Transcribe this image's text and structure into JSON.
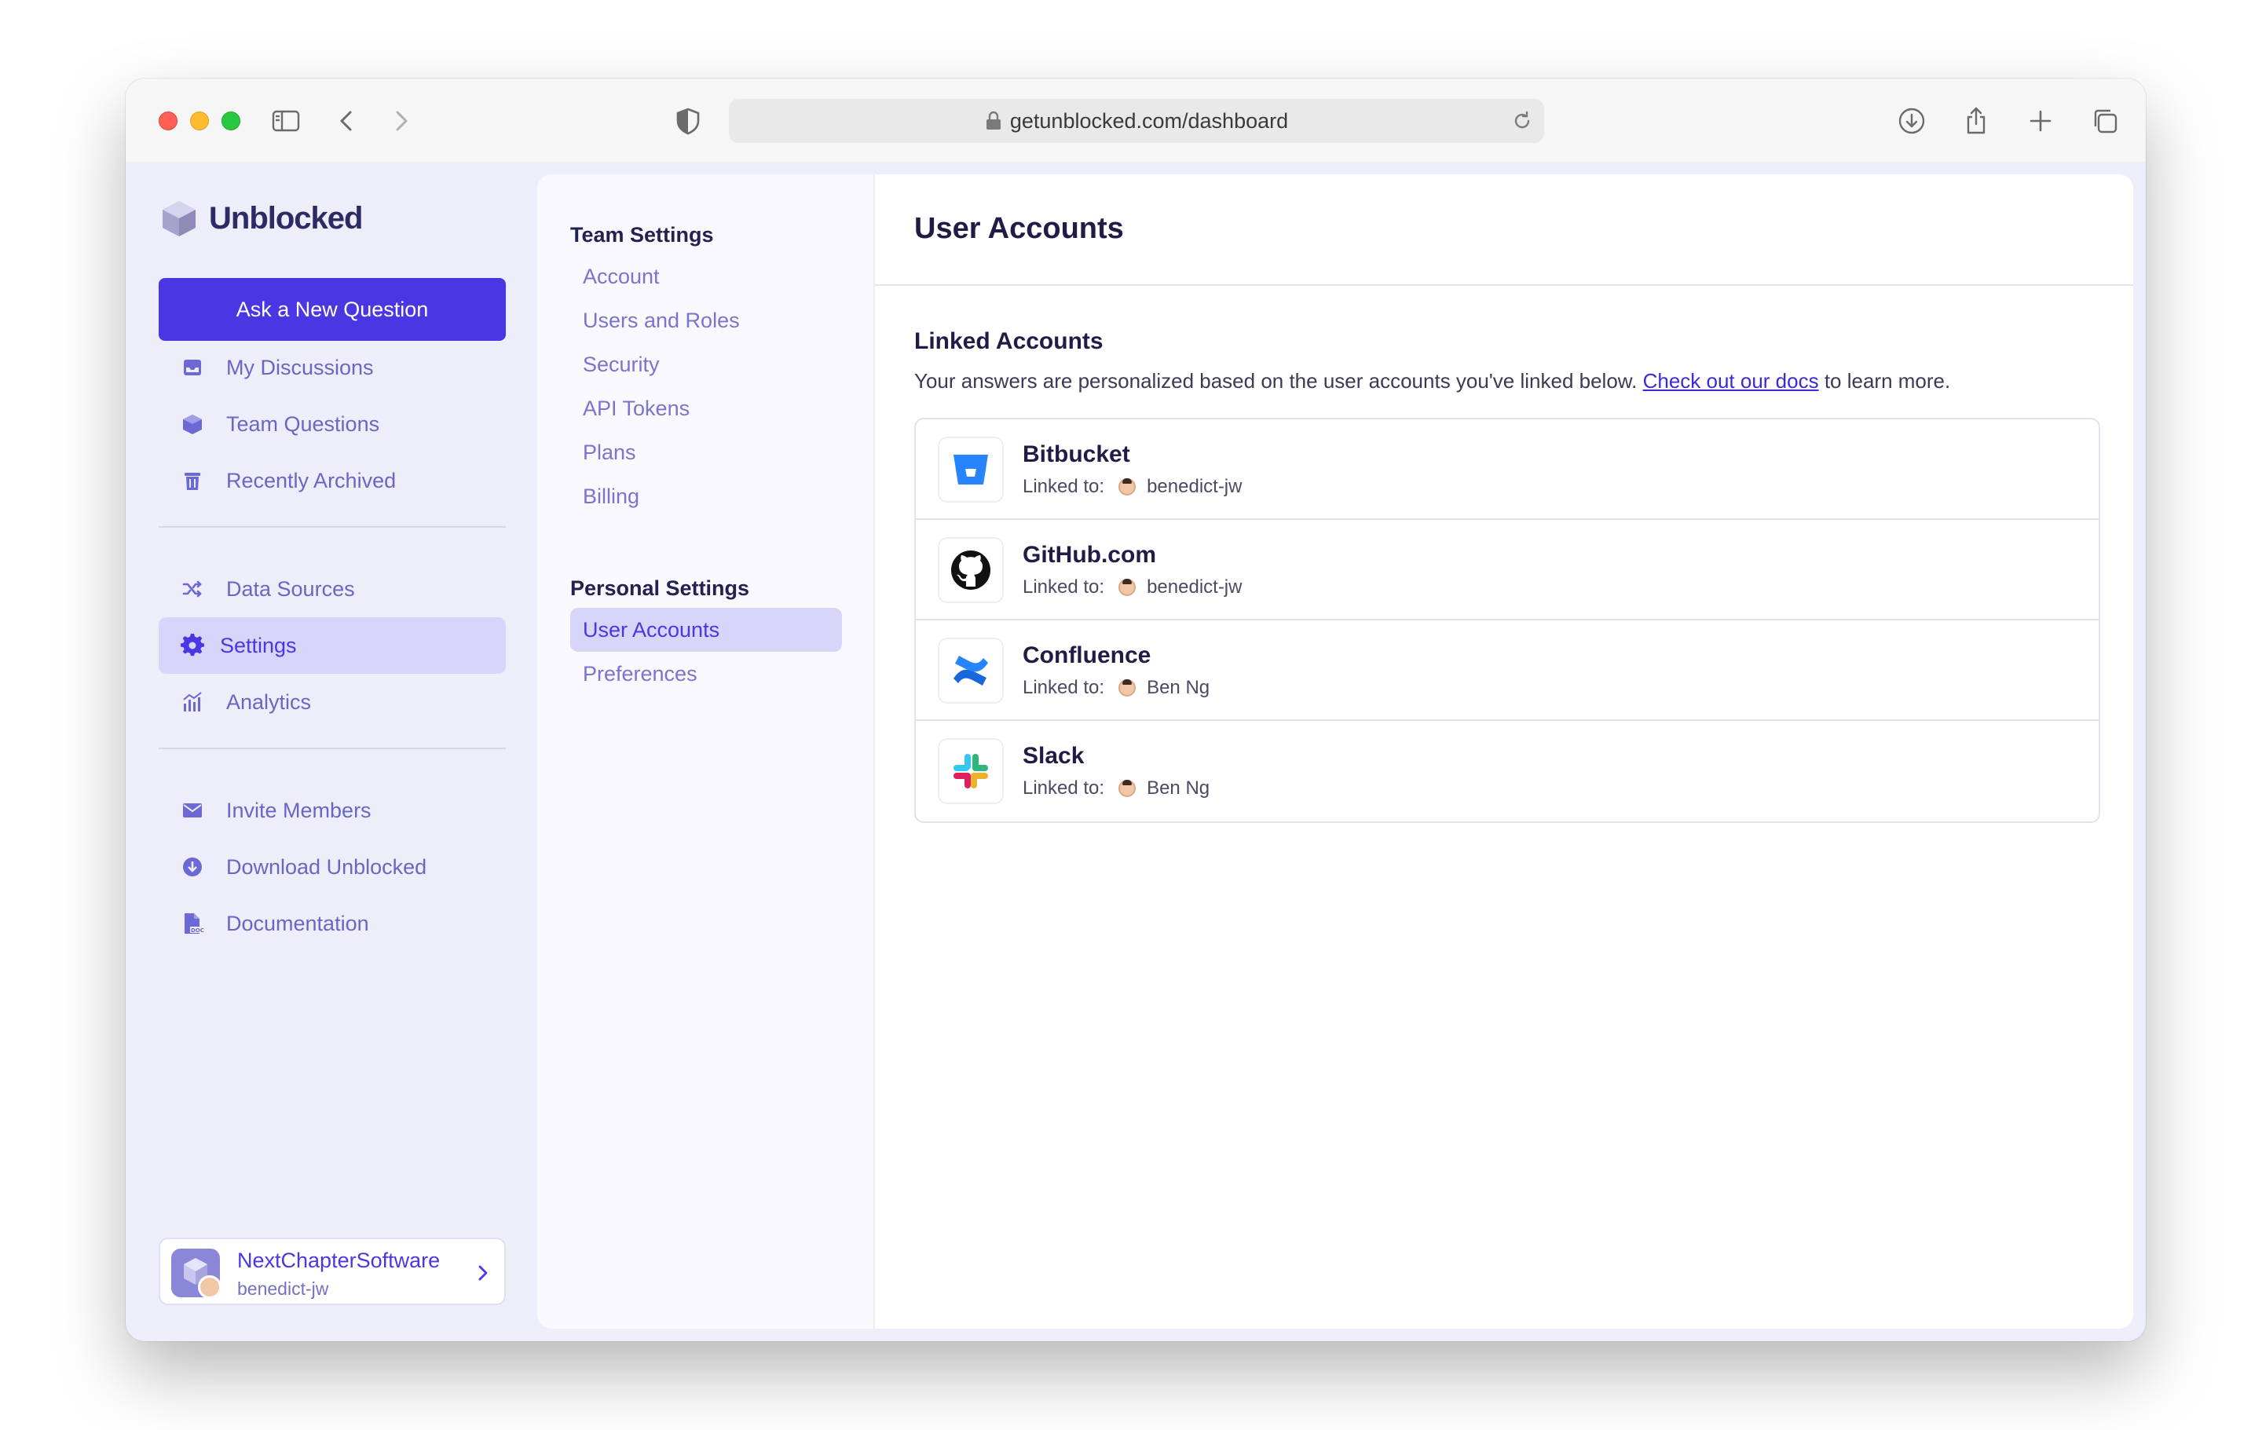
{
  "browser": {
    "url": "getunblocked.com/dashboard"
  },
  "brand": {
    "name": "Unblocked"
  },
  "sidebar": {
    "ask_button": "Ask a New Question",
    "primary": [
      {
        "label": "My Discussions",
        "icon": "inbox-icon"
      },
      {
        "label": "Team Questions",
        "icon": "cube-icon"
      },
      {
        "label": "Recently Archived",
        "icon": "trash-icon"
      }
    ],
    "secondary": [
      {
        "label": "Data Sources",
        "icon": "shuffle-icon"
      },
      {
        "label": "Settings",
        "icon": "gear-icon",
        "active": true
      },
      {
        "label": "Analytics",
        "icon": "analytics-icon"
      }
    ],
    "tertiary": [
      {
        "label": "Invite Members",
        "icon": "envelope-icon"
      },
      {
        "label": "Download Unblocked",
        "icon": "download-icon"
      },
      {
        "label": "Documentation",
        "icon": "doc-icon"
      }
    ],
    "org": {
      "name": "NextChapterSoftware",
      "user": "benedict-jw"
    }
  },
  "settings": {
    "team_header": "Team Settings",
    "team_items": [
      "Account",
      "Users and Roles",
      "Security",
      "API Tokens",
      "Plans",
      "Billing"
    ],
    "personal_header": "Personal Settings",
    "personal_items": [
      "User Accounts",
      "Preferences"
    ],
    "active": "User Accounts"
  },
  "main": {
    "title": "User Accounts",
    "section_title": "Linked Accounts",
    "desc_before": "Your answers are personalized based on the user accounts you've linked below. ",
    "desc_link": "Check out our docs",
    "desc_after": " to learn more.",
    "linked_label": "Linked to:",
    "accounts": [
      {
        "name": "Bitbucket",
        "user": "benedict-jw",
        "icon": "bitbucket-icon"
      },
      {
        "name": "GitHub.com",
        "user": "benedict-jw",
        "icon": "github-icon"
      },
      {
        "name": "Confluence",
        "user": "Ben Ng",
        "icon": "confluence-icon"
      },
      {
        "name": "Slack",
        "user": "Ben Ng",
        "icon": "slack-icon"
      }
    ]
  },
  "colors": {
    "accent": "#4a37e3",
    "sidebar_bg": "#eeedfa",
    "active_bg": "#d8d5fb"
  }
}
